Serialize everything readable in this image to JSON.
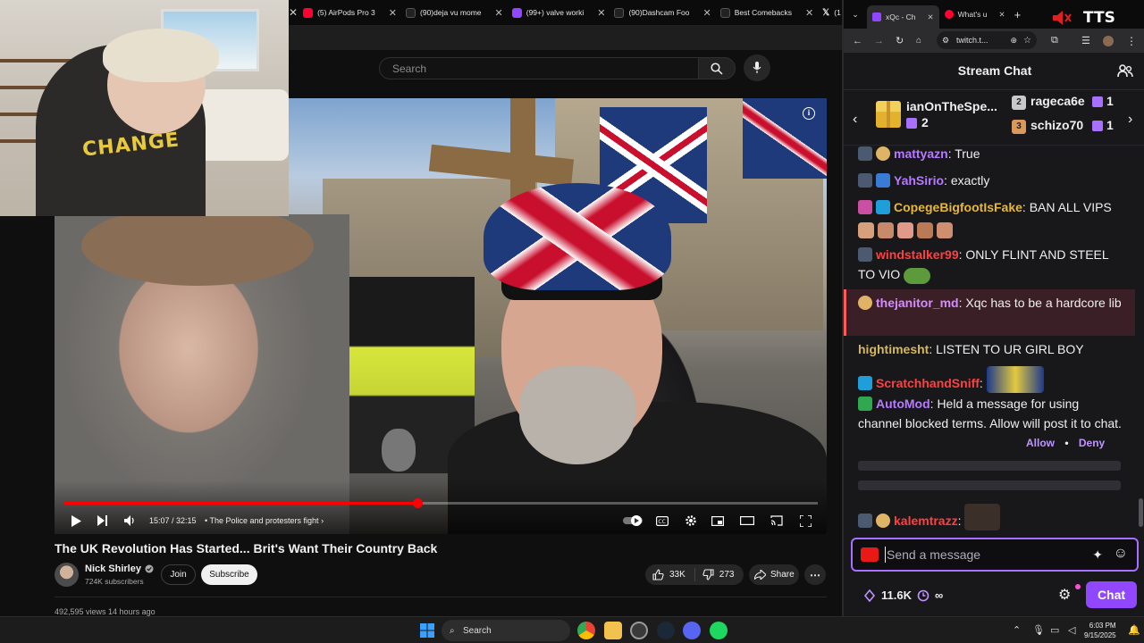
{
  "browser_left": {
    "tabs": [
      {
        "title": "(5) AirPods Pro 3",
        "fav_color": "#ff0033"
      },
      {
        "title": "(90)deja vu mome",
        "fav_color": "#222222"
      },
      {
        "title": "(99+) valve worki",
        "fav_color": "#9147ff"
      },
      {
        "title": "(90)Dashcam Foo",
        "fav_color": "#222222"
      },
      {
        "title": "Best Comebacks",
        "fav_color": "#2b2b2b"
      },
      {
        "title": "(1",
        "fav_color": "#111111"
      }
    ]
  },
  "youtube": {
    "search_placeholder": "Search",
    "video": {
      "time": "15:07 / 32:15",
      "chapter": "• The Police and protesters fight",
      "progress_fraction": 0.4687,
      "info_icon": "i"
    },
    "title": "The UK Revolution Has Started... Brit's Want Their Country Back",
    "channel": {
      "name": "Nick Shirley",
      "subscribers": "724K subscribers",
      "join_label": "Join",
      "subscribe_label": "Subscribe"
    },
    "likes": "33K",
    "dislikes": "273",
    "share_label": "Share",
    "views": "492,595 views  14 hours ago"
  },
  "webcam": {
    "shirt_text": "CHANGE"
  },
  "browser_right": {
    "tabs": [
      {
        "title": "xQc - Ch",
        "fav_color": "#9147ff",
        "active": true
      },
      {
        "title": "What's u",
        "fav_color": "#ff0033",
        "active": false
      }
    ],
    "address": "twitch.t...",
    "tts_label": "TTS"
  },
  "chat": {
    "header_title": "Stream Chat",
    "gift_bar": {
      "top_gifter": {
        "name": "ianOnTheSpe...",
        "count": "2"
      },
      "second": {
        "rank": "2",
        "name": "rageca6e",
        "count": "1"
      },
      "third": {
        "rank": "3",
        "name": "schizo70",
        "count": "1"
      }
    },
    "messages": [
      {
        "user": "mattyazn",
        "color": "#b57bff",
        "text": "True"
      },
      {
        "user": "YahSirio",
        "color": "#b57bff",
        "text": "exactly"
      },
      {
        "user": "CopegeBigfootIsFake",
        "color": "#e5b83a",
        "text": "BAN ALL VIPS"
      },
      {
        "user": "windstalker99",
        "color": "#ff4040",
        "text": "ONLY FLINT AND STEEL TO VIO"
      },
      {
        "user": "thejanitor_md",
        "color": "#d48cff",
        "text": "Xqc has to be a hardcore lib",
        "highlight": true
      },
      {
        "user": "hightimesht",
        "color": "#d7b85a",
        "text": "LISTEN TO UR GIRL BOY"
      },
      {
        "user": "ScratchhandSniff",
        "color": "#ff4040",
        "text": ""
      },
      {
        "user": "AutoMod",
        "color": "#b57bff",
        "text": "Held a message for using channel blocked terms. Allow will post it to chat."
      },
      {
        "user": "kalemtrazz",
        "color": "#ff4040",
        "text": ""
      }
    ],
    "automod_allow": "Allow",
    "automod_sep": "•",
    "automod_deny": "Deny",
    "input_placeholder": "Send a message",
    "points": "11.6K",
    "prediction": "∞",
    "chat_button": "Chat"
  },
  "taskbar": {
    "search_label": "Search",
    "time": "6:03 PM",
    "date": "9/15/2025"
  }
}
